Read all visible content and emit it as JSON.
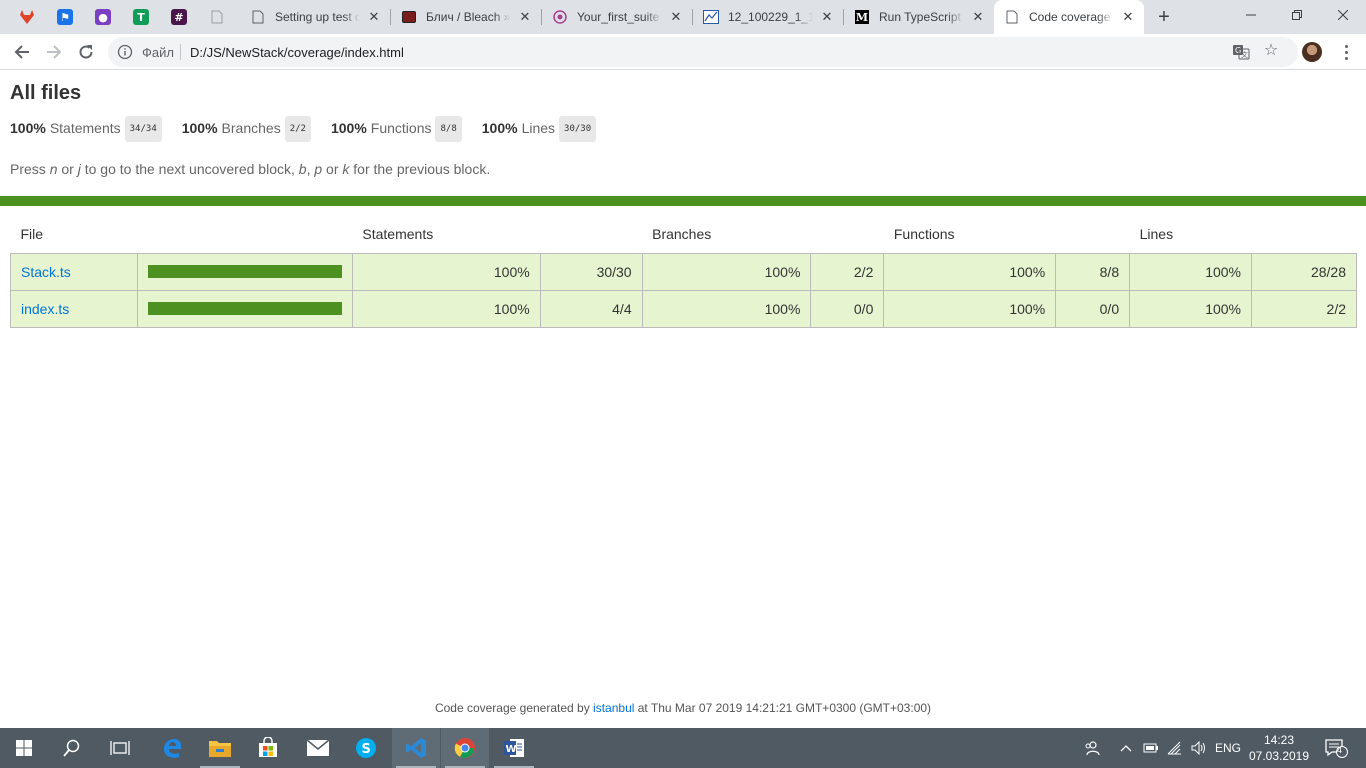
{
  "browser": {
    "tabs": [
      {
        "title": "Setting up test c",
        "icon": "document-icon"
      },
      {
        "title": "Блич / Bleach »",
        "icon": "anime-icon"
      },
      {
        "title": "Your_first_suite",
        "icon": "target-icon"
      },
      {
        "title": "12_100229_1_119",
        "icon": "doc-chart-icon"
      },
      {
        "title": "Run TypeScript f",
        "icon": "medium-icon"
      },
      {
        "title": "Code coverage r",
        "icon": "document-icon"
      }
    ],
    "pinned_tabs": [
      "gitlab-icon",
      "flag-icon",
      "meetup-icon",
      "sheets-icon",
      "slack-icon",
      "document-icon"
    ],
    "address": {
      "scheme_label": "Файл",
      "url": "D:/JS/NewStack/coverage/index.html"
    }
  },
  "page": {
    "title": "All files",
    "summary": [
      {
        "pct": "100%",
        "label": "Statements",
        "fraction": "34/34"
      },
      {
        "pct": "100%",
        "label": "Branches",
        "fraction": "2/2"
      },
      {
        "pct": "100%",
        "label": "Functions",
        "fraction": "8/8"
      },
      {
        "pct": "100%",
        "label": "Lines",
        "fraction": "30/30"
      }
    ],
    "hint": {
      "p1": "Press ",
      "k1": "n",
      "p2": " or ",
      "k2": "j",
      "p3": " to go to the next uncovered block, ",
      "k3": "b",
      "p4": ", ",
      "k4": "p",
      "p5": " or ",
      "k5": "k",
      "p6": " for the previous block."
    },
    "status_color": "#4d9221",
    "table": {
      "headers": {
        "file": "File",
        "statements": "Statements",
        "branches": "Branches",
        "functions": "Functions",
        "lines": "Lines"
      },
      "rows": [
        {
          "file": "Stack.ts",
          "coverage": 1.0,
          "statements_pct": "100%",
          "statements": "30/30",
          "branches_pct": "100%",
          "branches": "2/2",
          "functions_pct": "100%",
          "functions": "8/8",
          "lines_pct": "100%",
          "lines": "28/28"
        },
        {
          "file": "index.ts",
          "coverage": 1.0,
          "statements_pct": "100%",
          "statements": "4/4",
          "branches_pct": "100%",
          "branches": "0/0",
          "functions_pct": "100%",
          "functions": "0/0",
          "lines_pct": "100%",
          "lines": "2/2"
        }
      ]
    },
    "footer": {
      "prefix": "Code coverage generated by ",
      "link": "istanbul",
      "suffix": " at Thu Mar 07 2019 14:21:21 GMT+0300 (GMT+03:00)"
    }
  },
  "taskbar": {
    "apps": [
      "windows-start-icon",
      "search-icon",
      "task-view-icon",
      "edge-icon",
      "file-explorer-icon",
      "store-icon",
      "mail-icon",
      "skype-icon",
      "vscode-icon",
      "chrome-icon",
      "word-icon"
    ],
    "language": "ENG",
    "time": "14:23",
    "date": "07.03.2019",
    "notifications": "4"
  }
}
